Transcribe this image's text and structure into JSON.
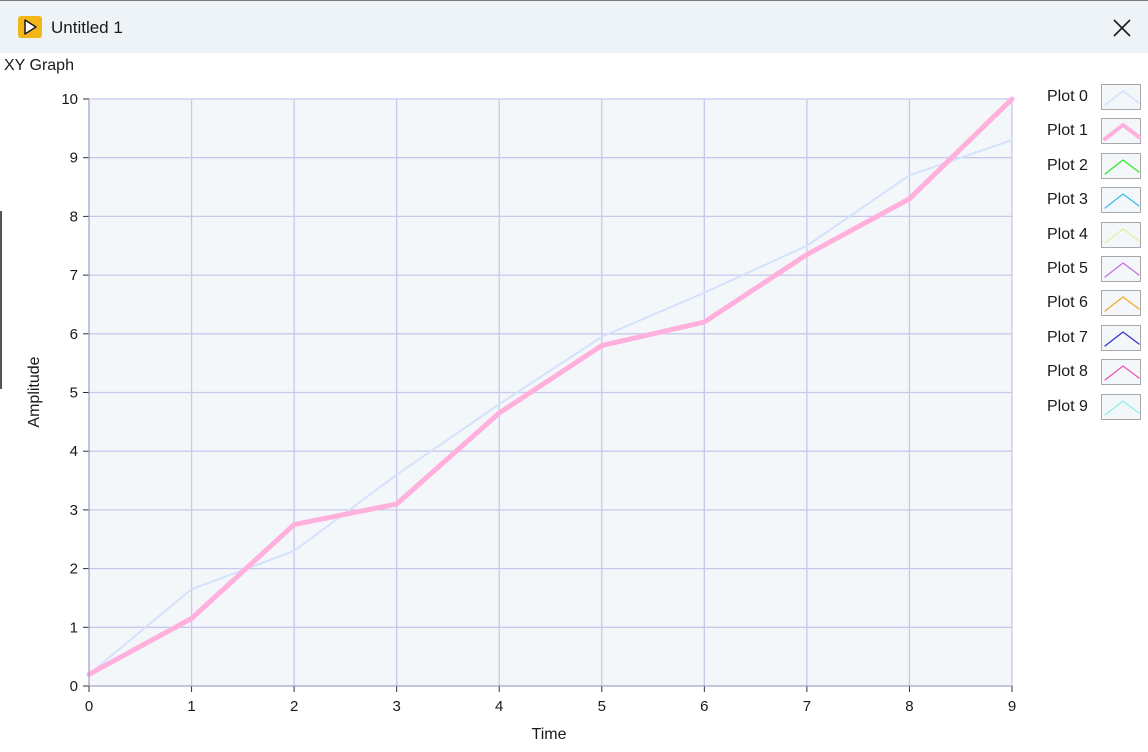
{
  "window": {
    "title": "Untitled 1",
    "icon": "labview-run-icon",
    "close_icon": "close-icon"
  },
  "graph": {
    "label": "XY Graph"
  },
  "colors": {
    "plot_area": "#f4f7f9",
    "grid": "#c8c8ee",
    "plot0": "#d4e2fb",
    "plot1": "#ffb0dd"
  },
  "chart_data": {
    "type": "line",
    "xlabel": "Time",
    "ylabel": "Amplitude",
    "xlim": [
      0,
      9
    ],
    "ylim": [
      0,
      10
    ],
    "xticks": [
      "0",
      "1",
      "2",
      "3",
      "4",
      "5",
      "6",
      "7",
      "8",
      "9"
    ],
    "yticks": [
      "0",
      "1",
      "2",
      "3",
      "4",
      "5",
      "6",
      "7",
      "8",
      "9",
      "10"
    ],
    "grid": true,
    "legend_position": "right",
    "series": [
      {
        "name": "Plot 0",
        "color": "#d4e2fb",
        "width": 2,
        "x": [
          0,
          1,
          2,
          3,
          4,
          5,
          6,
          7,
          8,
          9
        ],
        "y": [
          0.2,
          1.65,
          2.3,
          3.6,
          4.8,
          5.95,
          6.7,
          7.5,
          8.7,
          9.3
        ]
      },
      {
        "name": "Plot 1",
        "color": "#ffb0dd",
        "width": 5,
        "x": [
          0,
          1,
          2,
          3,
          4,
          5,
          6,
          7,
          8,
          9
        ],
        "y": [
          0.2,
          1.15,
          2.75,
          3.1,
          4.65,
          5.8,
          6.2,
          7.35,
          8.3,
          10.0
        ]
      }
    ]
  },
  "legend": [
    {
      "name": "Plot 0",
      "color": "#d4e2fb",
      "width": 1.5
    },
    {
      "name": "Plot 1",
      "color": "#ffb0dd",
      "width": 4
    },
    {
      "name": "Plot 2",
      "color": "#2ee82e",
      "width": 1.2
    },
    {
      "name": "Plot 3",
      "color": "#3cbcf0",
      "width": 1.2
    },
    {
      "name": "Plot 4",
      "color": "#d6f5a0",
      "width": 1.2
    },
    {
      "name": "Plot 5",
      "color": "#c070e0",
      "width": 1.2
    },
    {
      "name": "Plot 6",
      "color": "#f0a830",
      "width": 1.2
    },
    {
      "name": "Plot 7",
      "color": "#3030c8",
      "width": 1.2
    },
    {
      "name": "Plot 8",
      "color": "#f050b0",
      "width": 1.2
    },
    {
      "name": "Plot 9",
      "color": "#8ef0ec",
      "width": 1.2
    }
  ]
}
